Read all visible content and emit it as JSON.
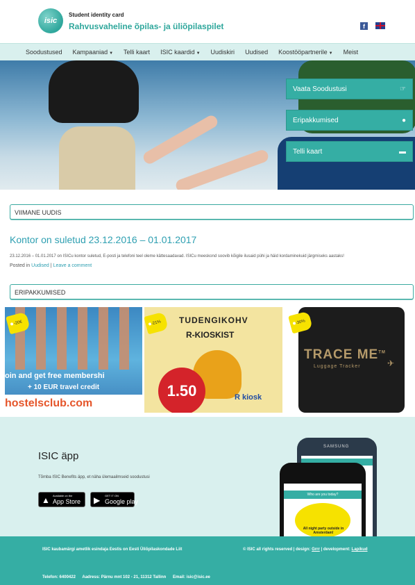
{
  "header": {
    "logo_text": "isic",
    "tagline": "Student identity card",
    "title": "Rahvusvaheline õpilas- ja üliõpilaspilet",
    "facebook_icon": "facebook-icon",
    "language_icon": "uk-flag-icon"
  },
  "nav": {
    "items": [
      {
        "label": "Soodustused",
        "dropdown": false
      },
      {
        "label": "Kampaaniad",
        "dropdown": true
      },
      {
        "label": "Telli kaart",
        "dropdown": false
      },
      {
        "label": "ISIC kaardid",
        "dropdown": true
      },
      {
        "label": "Uudiskiri",
        "dropdown": false
      },
      {
        "label": "Uudised",
        "dropdown": false
      },
      {
        "label": "Koostööpartnerile",
        "dropdown": true
      },
      {
        "label": "Meist",
        "dropdown": false
      }
    ]
  },
  "hero": {
    "buttons": [
      {
        "label": "Vaata Soodustusi",
        "icon": "hand-pointer-icon"
      },
      {
        "label": "Eripakkumised",
        "icon": "globe-icon"
      },
      {
        "label": "Telli kaart",
        "icon": "card-icon"
      }
    ]
  },
  "news": {
    "section_label": "VIIMANE UUDIS",
    "title": "Kontor on suletud 23.12.2016 – 01.01.2017",
    "body": "23.12.2016 – 01.01.2017 on ISICu kontor suletud, E-posti ja telefoni teel oleme kättesaadavad. ISICu meeskond soovib kõigile ilusaid pühi ja häid kordaminekuid järgmiseks aastaks!",
    "posted_in": "Posted in",
    "category": "Uudised",
    "separator": "|",
    "comment_link": "Leave a comment"
  },
  "offers": {
    "section_label": "ERIPAKKUMISED",
    "items": [
      {
        "discount": "-20€",
        "line1": "oin and get free membershi",
        "line2": "+ 10 EUR travel credit",
        "brand": "hostelsclub.com"
      },
      {
        "discount": "-21%",
        "head1": "TUDENGIKOHV",
        "head2": "R-KIOSKIST",
        "price": "1.50",
        "brand": "R kiosk"
      },
      {
        "discount": "-30%",
        "brand": "TRACE ME",
        "trademark": "TM",
        "subtitle": "Luggage Tracker"
      }
    ]
  },
  "app": {
    "title": "ISIC äpp",
    "description": "Tõmba ISIC Benefits äpp, et näha ülemaailmseid soodustusi",
    "app_store": {
      "small": "Available on the",
      "big": "App Store"
    },
    "google_play": {
      "small": "GET IT ON",
      "big": "Google play"
    },
    "phone_brand": "SAMSUNG",
    "phone_header": "Who are you today?",
    "phone_promo": "All night party outside in Amsterdam!"
  },
  "footer": {
    "representative": "ISIC kaubamärgi ametlik esindaja Eestis on Eesti Üliõpilaskondade Liit",
    "copyright": "© ISIC all rights reserved",
    "design_label": "design:",
    "design_by": "Grrr",
    "development_label": "development:",
    "development_by": "Lapikud",
    "phone": "Telefon: 6400422",
    "address": "Aadress: Pärnu mnt 102 - 21, 11312 Tallinn",
    "email": "Email: isic@isic.ee"
  }
}
